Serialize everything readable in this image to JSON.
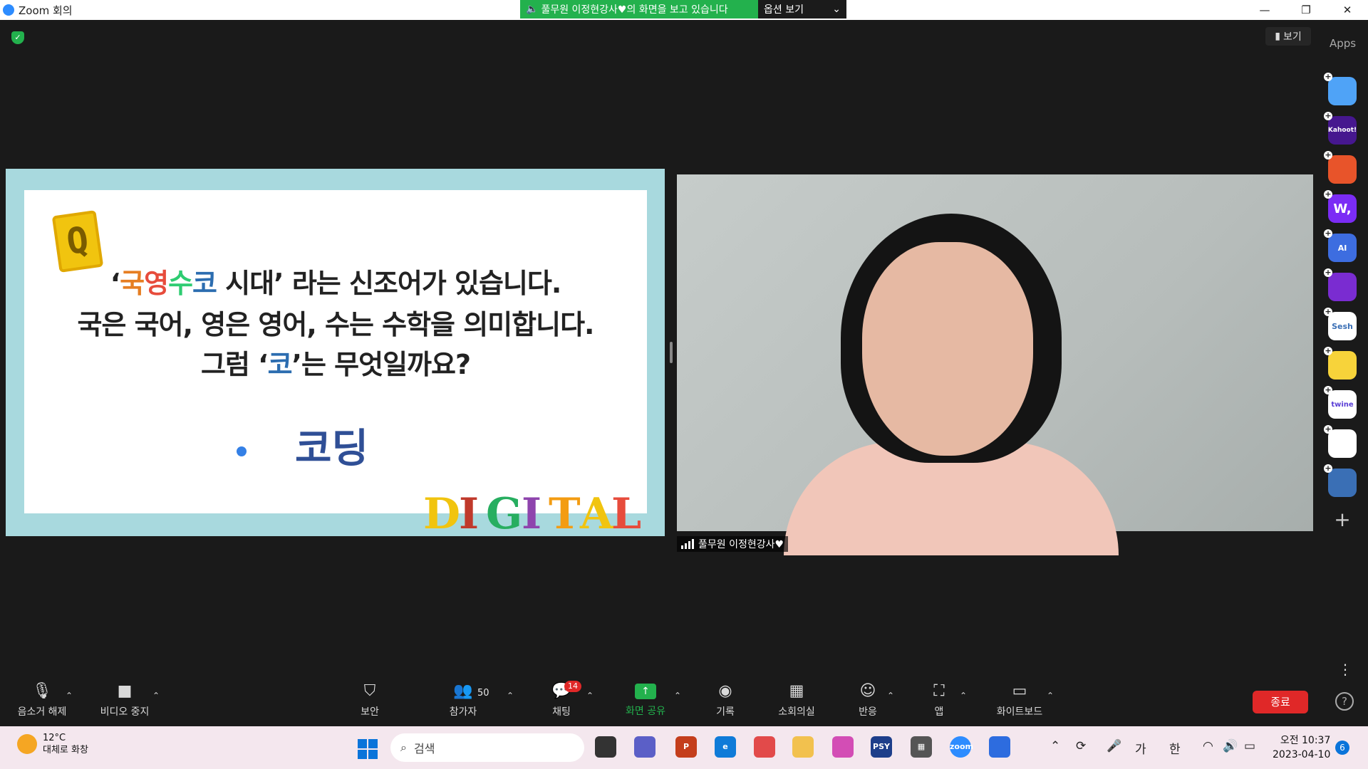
{
  "titlebar": {
    "title": "Zoom 회의",
    "share_message": "풀무원 이정현강사♥의 화면을 보고 있습니다",
    "options_label": "옵션 보기"
  },
  "top_right": {
    "view_label": "보기",
    "apps_label": "Apps"
  },
  "slide": {
    "line1_open": "‘",
    "line1_c1": "국",
    "line1_c2": "영",
    "line1_c3": "수",
    "line1_c4": "코",
    "line1_rest": " 시대’ 라는 신조어가 있습니다.",
    "line2": "국은 국어, 영은 영어, 수는 수학을 의미합니다.",
    "line3_a": "그럼 ‘",
    "line3_b": "코",
    "line3_c": "’는 무엇일까요?",
    "answer": "코딩",
    "q_letter": "Q",
    "digital_letters": [
      "D",
      "I",
      "G",
      "I",
      "T",
      "A",
      "L"
    ]
  },
  "video": {
    "participant_name": "풀무원 이정현강사♥"
  },
  "side_apps": [
    {
      "name": "flip",
      "label": "",
      "color": "#4fa3f7"
    },
    {
      "name": "kahoot",
      "label": "Kahoot!",
      "color": "#46178f"
    },
    {
      "name": "app3",
      "label": "",
      "color": "#e8542a"
    },
    {
      "name": "wooclap",
      "label": "W,",
      "color": "#7b2cf5"
    },
    {
      "name": "ai-app",
      "label": "AI",
      "color": "#3d6de0"
    },
    {
      "name": "app6",
      "label": "",
      "color": "#7a2cd1"
    },
    {
      "name": "sesh",
      "label": "Sesh",
      "color": "#ffffff"
    },
    {
      "name": "emoji-app",
      "label": "",
      "color": "#f7d33a"
    },
    {
      "name": "twine",
      "label": "twine",
      "color": "#ffffff"
    },
    {
      "name": "app10",
      "label": "",
      "color": "#ffffff"
    },
    {
      "name": "sync-app",
      "label": "",
      "color": "#3a6fb5"
    }
  ],
  "toolbar": {
    "unmute": "음소거 해제",
    "stop_video": "비디오 중지",
    "security": "보안",
    "participants": "참가자",
    "participants_count": "50",
    "chat": "채팅",
    "chat_badge": "14",
    "share_screen": "화면 공유",
    "record": "기록",
    "breakout": "소회의실",
    "reactions": "반응",
    "apps": "앱",
    "whiteboard": "화이트보드",
    "end": "종료"
  },
  "taskbar": {
    "temp": "12°C",
    "weather_desc": "대체로 화창",
    "search_placeholder": "검색",
    "ime_a": "가",
    "ime_b": "한",
    "time": "오전 10:37",
    "date": "2023-04-10",
    "notification_count": "6"
  }
}
